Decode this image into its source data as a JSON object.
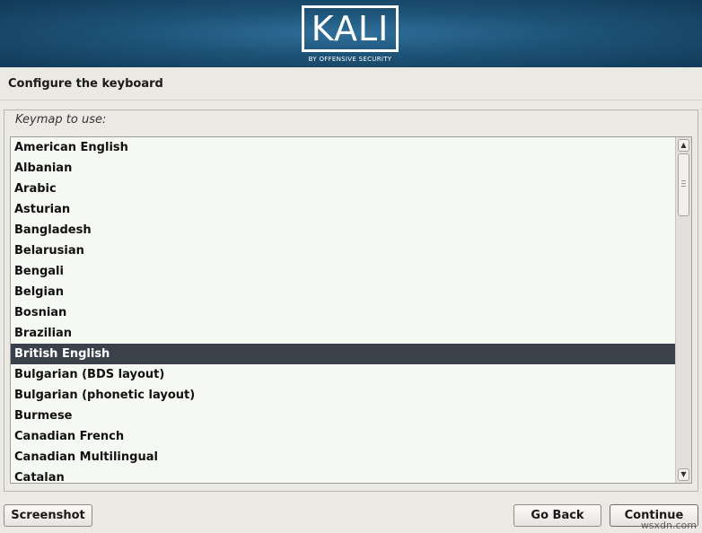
{
  "header": {
    "logo_text": "KALI",
    "logo_subtitle": "BY OFFENSIVE SECURITY"
  },
  "page": {
    "title": "Configure the keyboard"
  },
  "keymap": {
    "label": "Keymap to use:",
    "selected": "British English",
    "items": [
      "American English",
      "Albanian",
      "Arabic",
      "Asturian",
      "Bangladesh",
      "Belarusian",
      "Bengali",
      "Belgian",
      "Bosnian",
      "Brazilian",
      "British English",
      "Bulgarian (BDS layout)",
      "Bulgarian (phonetic layout)",
      "Burmese",
      "Canadian French",
      "Canadian Multilingual",
      "Catalan"
    ],
    "scroll_up_icon": "▲",
    "scroll_down_icon": "▼"
  },
  "buttons": {
    "screenshot": "Screenshot",
    "go_back": "Go Back",
    "continue": "Continue"
  },
  "watermark": "wsxdn.com"
}
